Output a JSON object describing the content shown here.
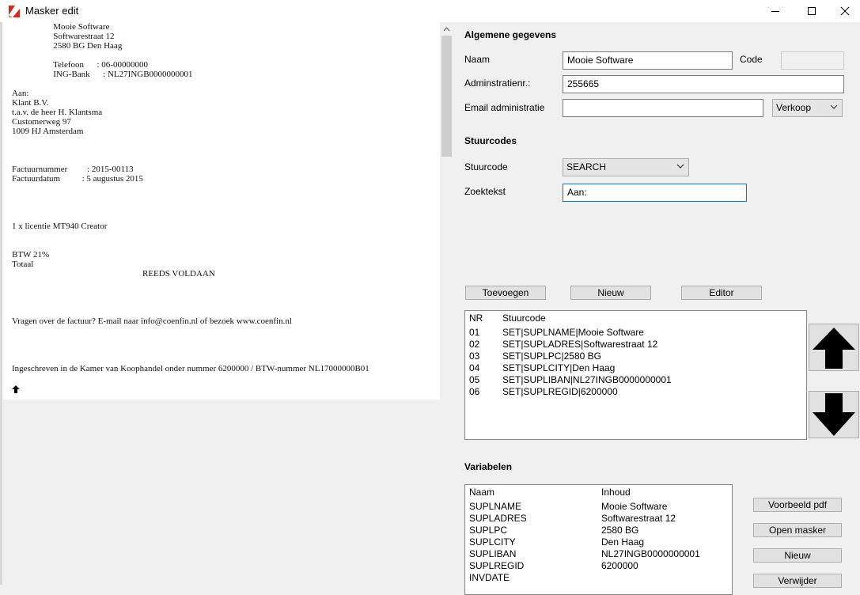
{
  "window": {
    "title": "Masker edit",
    "minimize_glyph": "—",
    "maximize_glyph": "☐",
    "close_glyph": "✕"
  },
  "preview": {
    "text": "                   Mooie Software\n                   Softwarestraat 12\n                   2580 BG Den Haag\n\n                   Telefoon      : 06-00000000\n                   ING-Bank      : NL27INGB0000000001\n\nAan:\nKlant B.V.\nt.a.v. de heer H. Klantsma\nCustomerweg 97\n1009 HJ Amsterdam\n\n\n\nFactuurnummer         : 2015-00113\nFactuurdatum          : 5 augustus 2015\n\n\n\n\n1 x licentie MT940 Creator\n\n\nBTW 21%\nTotaal\n                                                            REEDS VOLDAAN\n\n\n\n\nVragen over de factuur? E-mail naar info@coenfin.nl of bezoek www.coenfin.nl\n\n\n\n\nIngeschreven in de Kamer van Koophandel onder nummer 6200000 / BTW-nummer NL17000000B01"
  },
  "general": {
    "title": "Algemene gegevens",
    "naam_label": "Naam",
    "naam_value": "Mooie Software",
    "code_label": "Code",
    "code_value": "",
    "admin_label": "Adminstratienr.:",
    "admin_value": "255665",
    "email_label": "Email administratie",
    "email_value": "",
    "type_value": "Verkoop"
  },
  "stuurcodes": {
    "title": "Stuurcodes",
    "stuurcode_label": "Stuurcode",
    "stuurcode_value": "SEARCH",
    "zoektekst_label": "Zoektekst",
    "zoektekst_value": "Aan:",
    "btn_toevoegen": "Toevoegen",
    "btn_nieuw": "Nieuw",
    "btn_editor": "Editor",
    "col_nr": "NR",
    "col_stuurcode": "Stuurcode",
    "rows": [
      {
        "nr": "01",
        "code": "SET|SUPLNAME|Mooie Software"
      },
      {
        "nr": "02",
        "code": "SET|SUPLADRES|Softwarestraat 12"
      },
      {
        "nr": "03",
        "code": "SET|SUPLPC|2580 BG"
      },
      {
        "nr": "04",
        "code": "SET|SUPLCITY|Den Haag"
      },
      {
        "nr": "05",
        "code": "SET|SUPLIBAN|NL27INGB0000000001"
      },
      {
        "nr": "06",
        "code": "SET|SUPLREGID|6200000"
      }
    ]
  },
  "variabelen": {
    "title": "Variabelen",
    "col_naam": "Naam",
    "col_inhoud": "Inhoud",
    "rows": [
      {
        "naam": "SUPLNAME",
        "inhoud": "Mooie Software"
      },
      {
        "naam": "SUPLADRES",
        "inhoud": "Softwarestraat 12"
      },
      {
        "naam": "SUPLPC",
        "inhoud": "2580 BG"
      },
      {
        "naam": "SUPLCITY",
        "inhoud": "Den Haag"
      },
      {
        "naam": "SUPLIBAN",
        "inhoud": "NL27INGB0000000001"
      },
      {
        "naam": "SUPLREGID",
        "inhoud": "6200000"
      },
      {
        "naam": "INVDATE",
        "inhoud": ""
      }
    ],
    "btn_voorbeeld": "Voorbeeld pdf",
    "btn_open": "Open masker",
    "btn_nieuw": "Nieuw",
    "btn_verwijder": "Verwijder"
  }
}
